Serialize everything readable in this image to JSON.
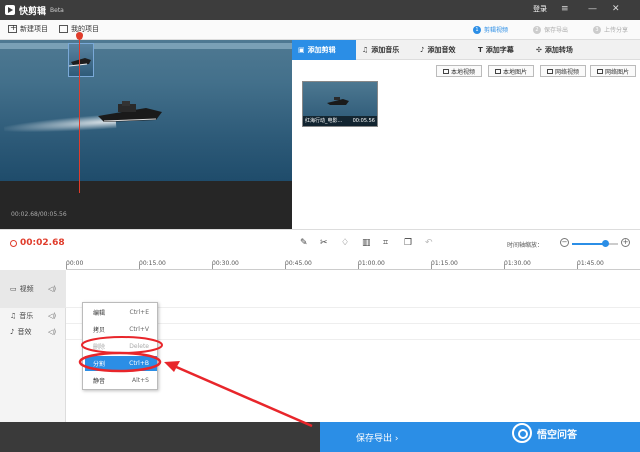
{
  "titlebar": {
    "app_name": "快剪辑",
    "beta": "Beta",
    "login": "登录",
    "controls": {
      "menu": "≡",
      "minimize": "—",
      "maximize": "☐",
      "close": "✕"
    }
  },
  "toolbar": {
    "new_project": "新建项目",
    "my_projects": "我的项目",
    "steps": [
      {
        "num": "1",
        "label": "剪辑视频"
      },
      {
        "num": "2",
        "label": "保存导出"
      },
      {
        "num": "3",
        "label": "上传分享"
      }
    ]
  },
  "preview": {
    "time_readout": "00:02.68/00:05.56"
  },
  "panel": {
    "tabs": [
      {
        "label": "添加剪辑"
      },
      {
        "label": "添加音乐"
      },
      {
        "label": "添加音效"
      },
      {
        "label": "添加字幕"
      },
      {
        "label": "添加转场"
      }
    ],
    "media_buttons": [
      "本地视频",
      "本地图片",
      "网络视频",
      "网络图片"
    ],
    "thumbnail_label": "红海行动_电影...",
    "thumbnail_duration": "00:05.56"
  },
  "timeline": {
    "current_time": "00:02.68",
    "zoom_label": "时间轴缩放：",
    "zoom_level": 0.72,
    "ruler_labels": [
      "00:00",
      "00:15.00",
      "00:30.00",
      "00:45.00",
      "01:00.00",
      "01:15.00",
      "01:30.00",
      "01:45.00"
    ],
    "tracks": [
      {
        "label": "视频"
      },
      {
        "label": "音乐"
      },
      {
        "label": "音效"
      }
    ]
  },
  "context_menu": {
    "items": [
      {
        "label": "编辑",
        "shortcut": "Ctrl+E"
      },
      {
        "label": "拷贝",
        "shortcut": "Ctrl+V"
      },
      {
        "label": "删除",
        "shortcut": "Delete"
      },
      {
        "label": "分割",
        "shortcut": "Ctrl+B"
      },
      {
        "label": "静音",
        "shortcut": "Alt+S"
      }
    ]
  },
  "bottom": {
    "export_label": "保存导出 ›",
    "watermark": "悟空问答"
  },
  "colors": {
    "accent": "#2b8ee6",
    "playhead": "#e03c2b",
    "annotation": "#e8262b"
  }
}
